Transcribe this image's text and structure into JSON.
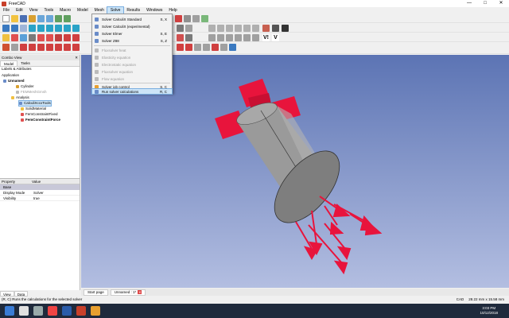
{
  "window": {
    "title": "FreeCAD",
    "controls": [
      "—",
      "□",
      "✕"
    ]
  },
  "menubar": [
    "File",
    "Edit",
    "View",
    "Tools",
    "Macro",
    "Model",
    "Mesh",
    "Solve",
    "Results",
    "Windows",
    "Help"
  ],
  "solve_menu": {
    "items": [
      {
        "label": "Solver CalculiX Standard",
        "shortcut": "S, X",
        "enabled": true
      },
      {
        "label": "Solver CalculiX (experimental)",
        "shortcut": "",
        "enabled": true
      },
      {
        "label": "Solver Elmer",
        "shortcut": "S, E",
        "enabled": true
      },
      {
        "label": "Solver Z88",
        "shortcut": "S, Z",
        "enabled": true
      },
      {
        "label": "Fluxsolver heat",
        "shortcut": "",
        "enabled": false
      },
      {
        "label": "Elasticity equation",
        "shortcut": "",
        "enabled": false
      },
      {
        "label": "Electrostatic equation",
        "shortcut": "",
        "enabled": false
      },
      {
        "label": "Fluxsolver equation",
        "shortcut": "",
        "enabled": false
      },
      {
        "label": "Flow equation",
        "shortcut": "",
        "enabled": false
      },
      {
        "label": "Solver job control",
        "shortcut": "S, C",
        "enabled": true
      },
      {
        "label": "Run solver calculations",
        "shortcut": "R, C",
        "enabled": true,
        "highlighted": true
      }
    ]
  },
  "combo_view": {
    "title": "Combo View",
    "tabs": [
      "Model",
      "Tasks"
    ],
    "labels_header": "Labels & Attributes",
    "application_label": "Application",
    "tree": [
      {
        "label": "Unnamed",
        "bold": true
      },
      {
        "label": "Cylinder"
      },
      {
        "label": "FEMMeshGmsh",
        "muted": true
      },
      {
        "label": "Analysis"
      },
      {
        "label": "CalculiXccxTools",
        "selected": true
      },
      {
        "label": "SolidMaterial"
      },
      {
        "label": "FemConstraintFixed"
      },
      {
        "label": "FemConstraintForce",
        "bold": true
      }
    ]
  },
  "property_grid": {
    "headers": [
      "Property",
      "Value"
    ],
    "group": "Base",
    "rows": [
      {
        "name": "Display Mode",
        "value": "Solver"
      },
      {
        "name": "Visibility",
        "value": "true"
      }
    ]
  },
  "panel_tabs": [
    "View",
    "Data"
  ],
  "doc_tabs": [
    "Start page",
    "Unnamed : 1*"
  ],
  "statusbar": {
    "message": "(R, C) Runs the calculations for the selected solver",
    "nav": "CAD",
    "dimensions": "28.22 mm x 15.58 mm"
  },
  "clock": {
    "time": "3:03 PM",
    "date": "10/12/2018"
  },
  "colors": {
    "accent": "#cce4f7",
    "constraint": "#e8143c",
    "viewport_top": "#5c74b4",
    "viewport_bottom": "#b3bee1"
  },
  "icons": [
    "freecad-icon",
    "new-file-icon",
    "open-file-icon",
    "save-icon",
    "fem-constraint-icon",
    "cylinder-part-icon",
    "analysis-icon",
    "material-icon"
  ]
}
